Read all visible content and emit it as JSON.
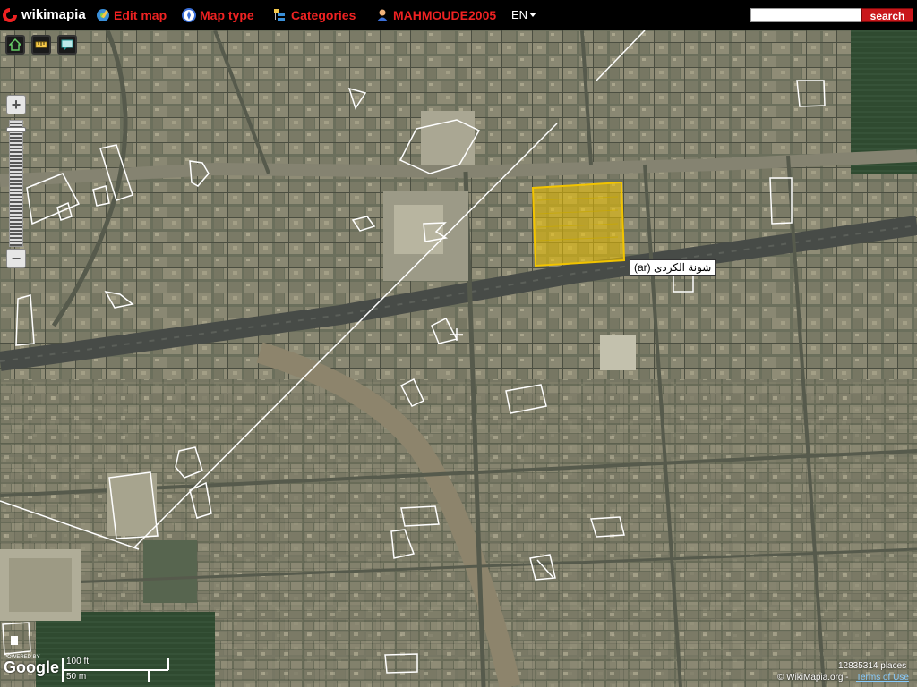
{
  "topbar": {
    "logo_label": "wikimapia",
    "edit_map_label": "Edit map",
    "map_type_label": "Map type",
    "categories_label": "Categories",
    "user_label": "MAHMOUDE2005",
    "language_label": "EN",
    "search_value": "",
    "search_button_label": "search"
  },
  "map": {
    "selected_place_label": "شونة الكردى (ar)",
    "selected_place_color": "#f2c400",
    "scale_top_label": "100 ft",
    "scale_bottom_label": "50 m",
    "powered_by_label": "POWERED BY",
    "google_label": "Google",
    "places_count_label": "12835314 places",
    "copyright_label": "© WikiMapia.org -",
    "terms_label": "Terms of Use",
    "zoom_in_label": "+",
    "zoom_out_label": "−"
  },
  "icons": [
    "wikimapia-logo-icon",
    "edit-map-icon",
    "map-type-icon",
    "categories-icon",
    "user-icon",
    "dropdown-caret-icon",
    "home-tool-icon",
    "ruler-tool-icon",
    "comment-tool-icon"
  ],
  "colors": {
    "accent": "#e22222",
    "topbar_bg": "#000000",
    "search_button_bg": "#c9171b"
  }
}
